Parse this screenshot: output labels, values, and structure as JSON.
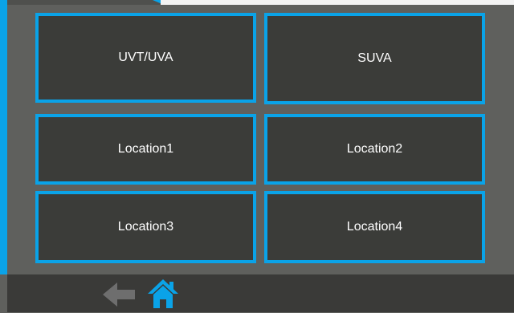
{
  "tiles": [
    {
      "id": "uvt-uva",
      "label": "UVT/UVA"
    },
    {
      "id": "suva",
      "label": "SUVA"
    },
    {
      "id": "location1",
      "label": "Location1"
    },
    {
      "id": "location2",
      "label": "Location2"
    },
    {
      "id": "location3",
      "label": "Location3"
    },
    {
      "id": "location4",
      "label": "Location4"
    }
  ],
  "footer": {
    "back_icon": "left-arrow-icon",
    "home_icon": "home-icon"
  },
  "colors": {
    "accent": "#0aa3e8",
    "tile_bg": "#3b3c39",
    "page_bg": "#5f605d",
    "footer_bg": "#3a3a38",
    "back_arrow": "#6e6e6e"
  }
}
